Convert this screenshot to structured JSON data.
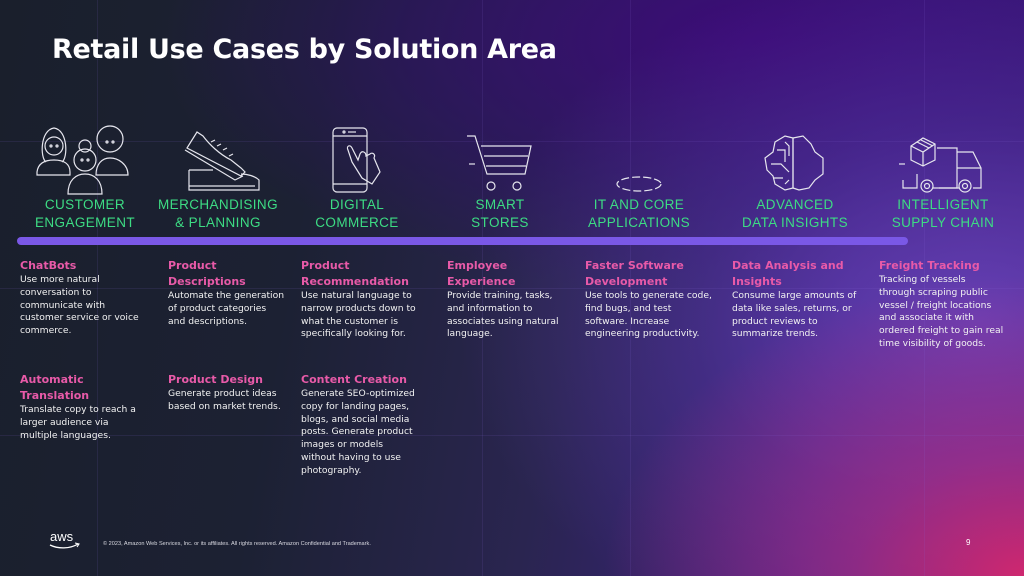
{
  "slide": {
    "title": "Retail Use Cases by Solution Area",
    "page_number": "9",
    "accent_colors": {
      "category_label": "#3ddc84",
      "use_case_title": "#e85aa8",
      "divider_bar": "#7a58e6"
    }
  },
  "categories": [
    {
      "label": "CUSTOMER\nENGAGEMENT",
      "icon": "people-group-icon"
    },
    {
      "label": "MERCHANDISING\n& PLANNING",
      "icon": "sneaker-shoe-icon"
    },
    {
      "label": "DIGITAL\nCOMMERCE",
      "icon": "smartphone-tap-icon"
    },
    {
      "label": "SMART\nSTORES",
      "icon": "shopping-cart-icon"
    },
    {
      "label": "IT AND CORE\nAPPLICATIONS",
      "icon": "ellipse-icon"
    },
    {
      "label": "ADVANCED\nDATA INSIGHTS",
      "icon": "brain-circuit-icon"
    },
    {
      "label": "INTELLIGENT\nSUPPLY CHAIN",
      "icon": "delivery-truck-icon"
    }
  ],
  "use_cases": [
    {
      "title": "ChatBots",
      "desc": "Use more natural conversation to communicate with customer service or voice commerce."
    },
    {
      "title": "Automatic Translation",
      "desc": "Translate copy to reach a larger audience via multiple languages."
    },
    {
      "title": "Product Descriptions",
      "desc": "Automate the generation of product categories and descriptions."
    },
    {
      "title": "Product Design",
      "desc": "Generate product ideas based on market trends."
    },
    {
      "title": "Product Recommendation",
      "desc": "Use natural language to narrow products down to what the customer is specifically looking for."
    },
    {
      "title": "Content  Creation",
      "desc": "Generate SEO-optimized copy for landing pages, blogs, and social media posts. Generate product images or models without having to use photography."
    },
    {
      "title": "Employee Experience",
      "desc": "Provide training, tasks, and information to associates using natural language."
    },
    {
      "title": "Faster Software Development",
      "desc": "Use tools to generate code, find bugs, and test software.  Increase engineering productivity."
    },
    {
      "title": "Data Analysis and Insights",
      "desc": "Consume large amounts of data like sales, returns, or product reviews to summarize trends."
    },
    {
      "title": "Freight Tracking",
      "desc": "Tracking of vessels through scraping public vessel / freight locations and associate it  with ordered freight to gain real time visibility of goods."
    }
  ],
  "footer": {
    "logo": "aws-logo",
    "logo_text": "aws",
    "copyright": "© 2023, Amazon Web Services, Inc. or its affiliates. All rights reserved. Amazon Confidential and Trademark."
  }
}
